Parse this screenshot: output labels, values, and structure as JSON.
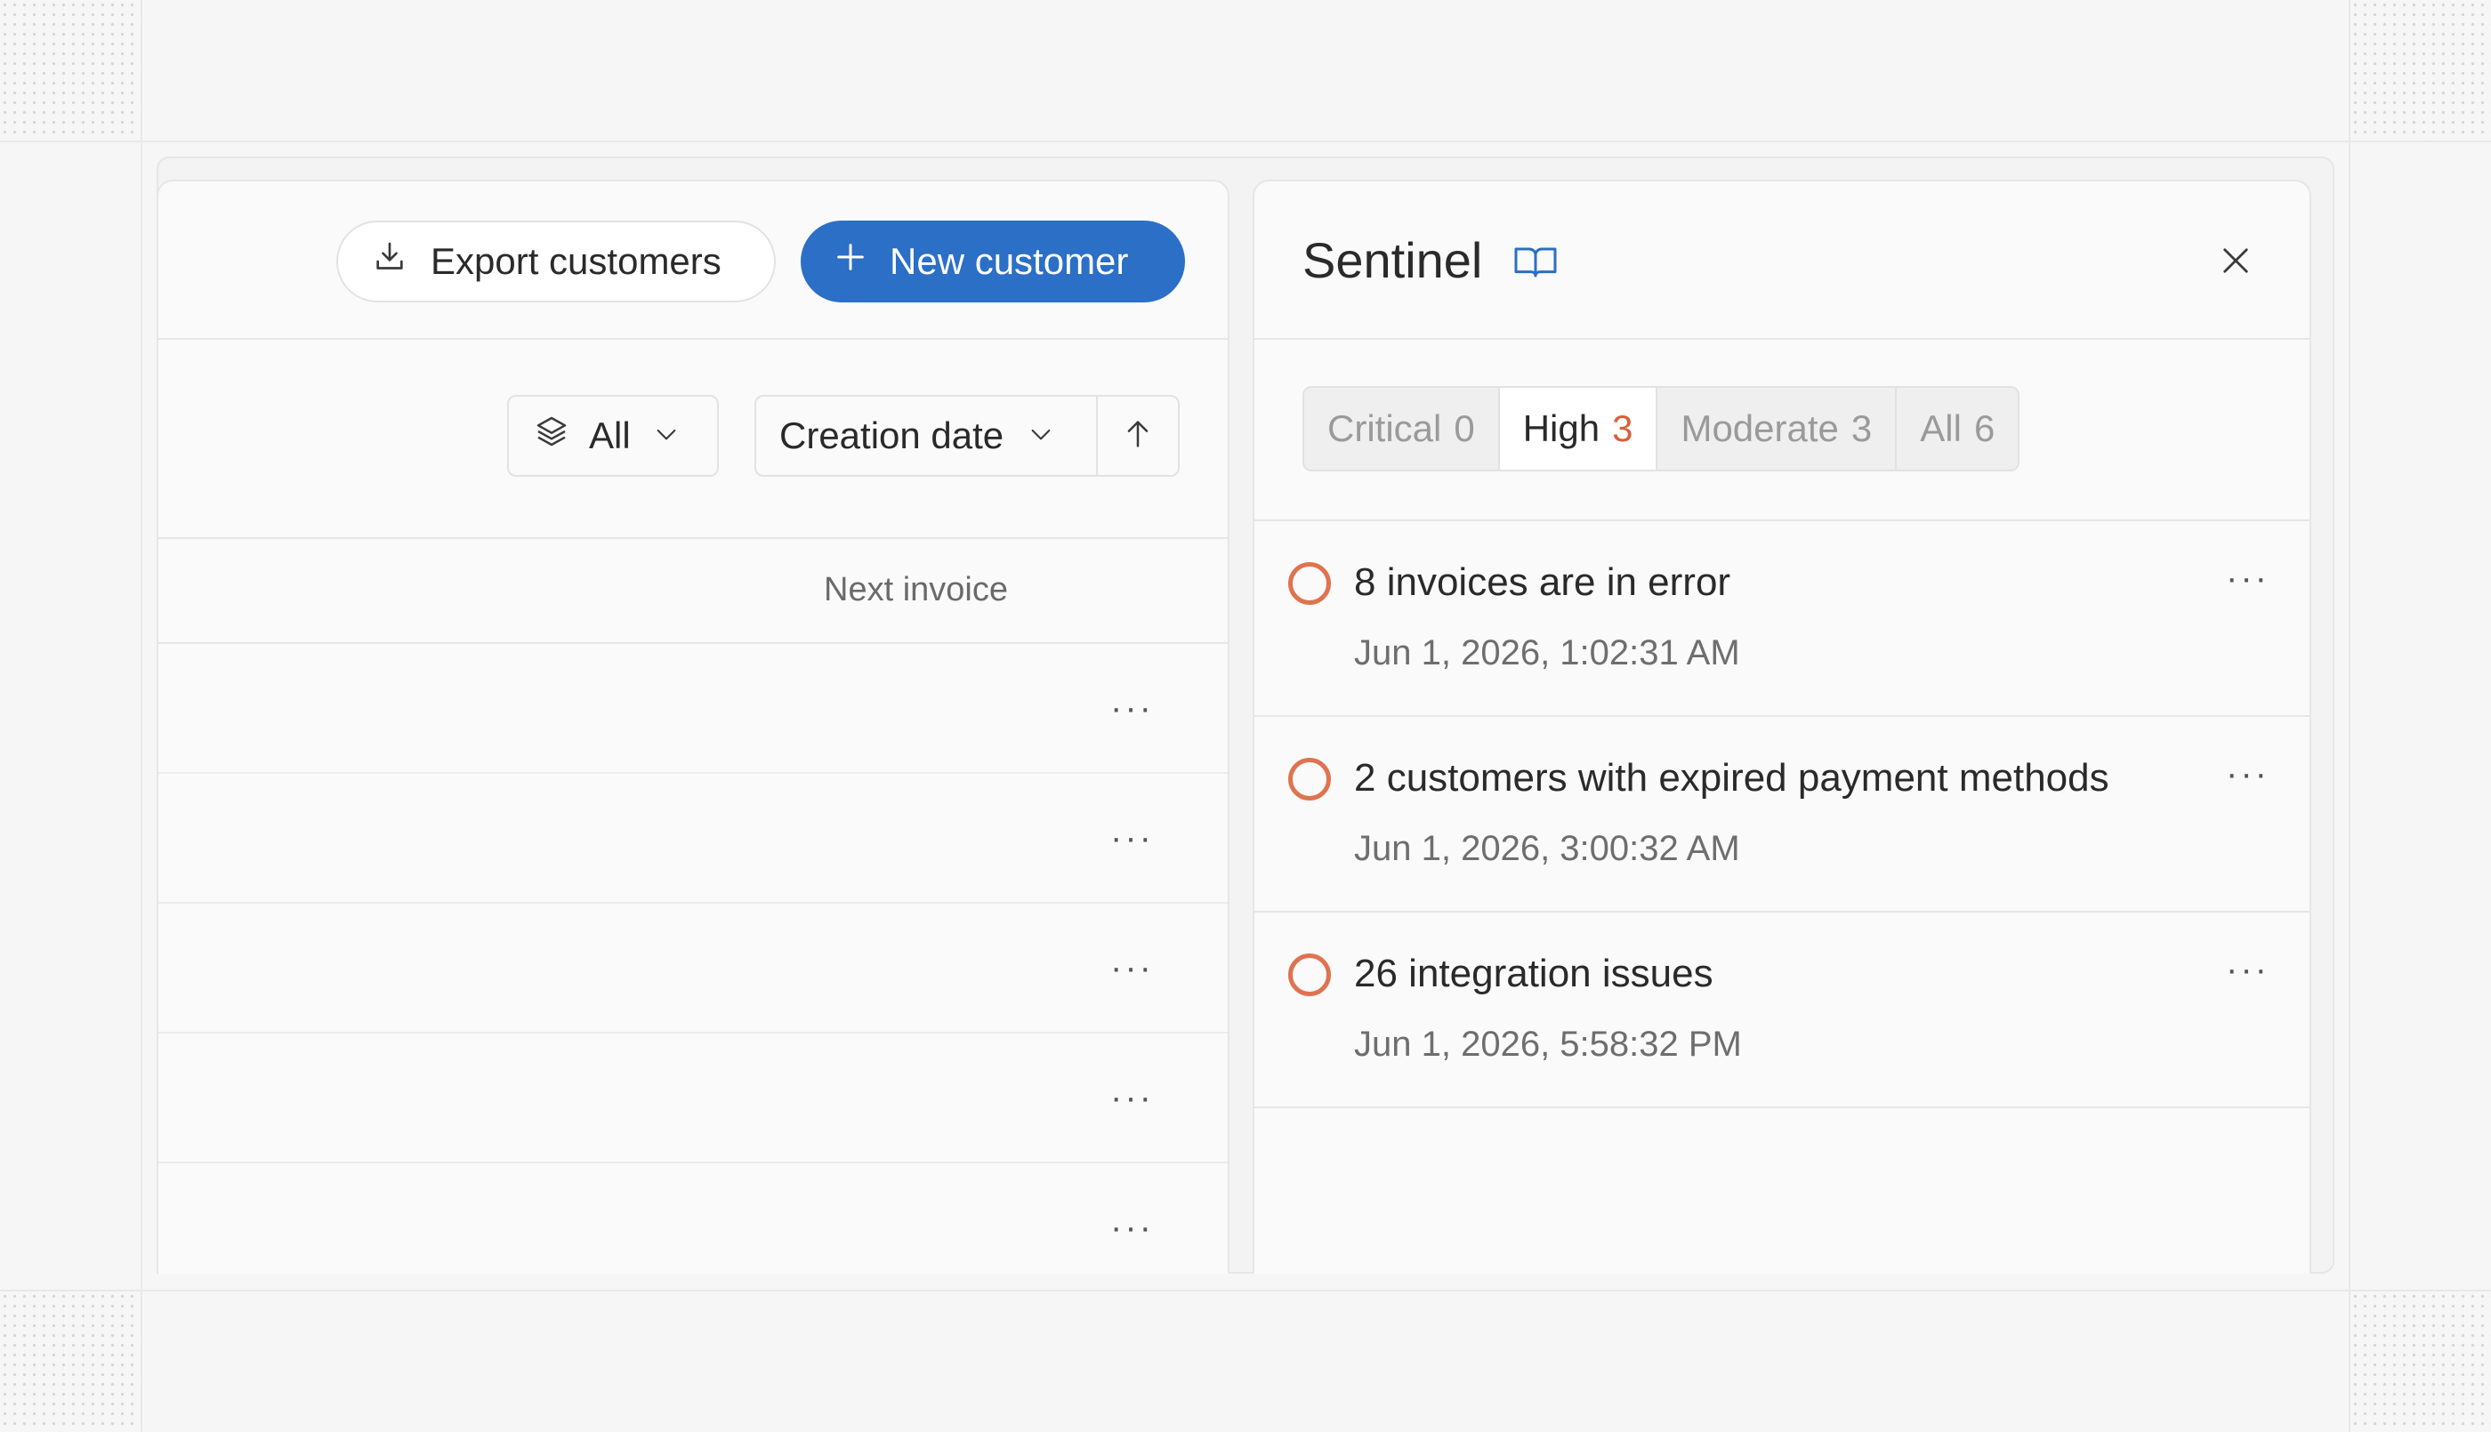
{
  "customers": {
    "export_label": "Export customers",
    "new_label": "New customer",
    "filter": {
      "selected": "All"
    },
    "sort": {
      "field": "Creation date",
      "direction": "ascending"
    },
    "columns": [
      "Next invoice"
    ],
    "row_menu": "···",
    "rows": [
      {},
      {},
      {},
      {},
      {}
    ]
  },
  "sentinel": {
    "title": "Sentinel",
    "tabs": [
      {
        "label": "Critical",
        "count": "0",
        "active": false
      },
      {
        "label": "High",
        "count": "3",
        "active": true
      },
      {
        "label": "Moderate",
        "count": "3",
        "active": false
      },
      {
        "label": "All",
        "count": "6",
        "active": false
      }
    ],
    "issue_menu": "···",
    "issues": [
      {
        "title": "8 invoices are in error",
        "time": "Jun 1, 2026, 1:02:31 AM"
      },
      {
        "title": "2 customers with expired payment methods",
        "time": "Jun 1, 2026, 3:00:32 AM"
      },
      {
        "title": "26 integration issues",
        "time": "Jun 1, 2026, 5:58:32 PM"
      }
    ]
  },
  "colors": {
    "accent": "#2b6fc6",
    "severity_high": "#e0734f",
    "high_count": "#d9603b"
  }
}
